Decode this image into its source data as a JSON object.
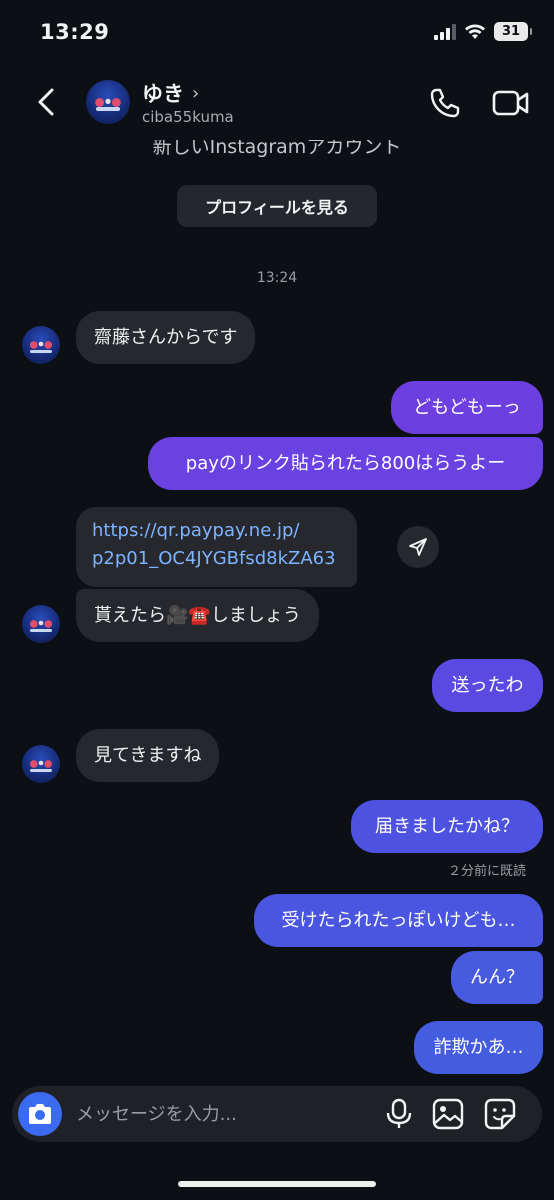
{
  "status_bar": {
    "time": "13:29",
    "battery": "31"
  },
  "header": {
    "name": "ゆき",
    "chevron": "›",
    "username": "ciba55kuma",
    "icons": [
      "back-arrow-icon",
      "phone-icon",
      "video-camera-icon"
    ]
  },
  "thread_intro": {
    "clipped_text": "新しいInstagramアカウント",
    "profile_button": "プロフィールを見る"
  },
  "timestamp": "13:24",
  "messages": [
    {
      "sender": "them",
      "text": "齋藤さんからです"
    },
    {
      "sender": "me",
      "text": "どもどもーっ"
    },
    {
      "sender": "me",
      "text": "payのリンク貼られたら800はらうよー"
    },
    {
      "sender": "them",
      "type": "link",
      "line1": "https://qr.paypay.ne.jp/",
      "line2": "p2p01_OC4JYGBfsd8kZA63"
    },
    {
      "sender": "them",
      "text": "貰えたら🎥☎️しましょう"
    },
    {
      "sender": "me",
      "text": "送ったわ"
    },
    {
      "sender": "them",
      "text": "見てきますね"
    },
    {
      "sender": "me",
      "text": "届きましたかね？"
    },
    {
      "sender": "me",
      "text": "受けたられたっぽいけども…"
    },
    {
      "sender": "me",
      "text": "んん？"
    },
    {
      "sender": "me",
      "text": "詐欺かあ…"
    }
  ],
  "seen_status": "２分前に既読",
  "composer": {
    "placeholder": "メッセージを入力..."
  },
  "colors": {
    "background": "#0c0f14",
    "incoming_bubble": "#26282e",
    "outgoing_purple": "#6e3fe0",
    "outgoing_blue": "#4a56e0",
    "link": "#7db4ff",
    "camera_button": "#3a6bf0"
  }
}
